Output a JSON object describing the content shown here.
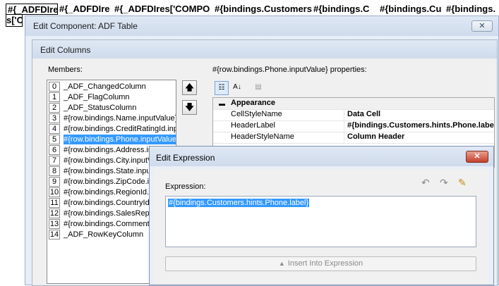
{
  "background": {
    "header_cells": [
      "#{_ADFDIre",
      "#{_ADFDIre",
      "#{_ADFDIres['COMPO",
      "#{bindings.Customers",
      "#{bindings.C",
      "#{bindings.Cu",
      "#{bindings."
    ],
    "row2_text": "s['C"
  },
  "edit_component": {
    "title": "Edit Component: ADF Table",
    "close_icon": "close-icon"
  },
  "edit_columns": {
    "title": "Edit Columns",
    "members_label": "Members:",
    "members": [
      {
        "index": "0",
        "label": "_ADF_ChangedColumn"
      },
      {
        "index": "1",
        "label": "_ADF_FlagColumn"
      },
      {
        "index": "2",
        "label": "_ADF_StatusColumn"
      },
      {
        "index": "3",
        "label": "#{row.bindings.Name.inputValue}"
      },
      {
        "index": "4",
        "label": "#{row.bindings.CreditRatingId.inputValue}"
      },
      {
        "index": "5",
        "label": "#{row.bindings.Phone.inputValue}"
      },
      {
        "index": "6",
        "label": "#{row.bindings.Address.inputValue}"
      },
      {
        "index": "7",
        "label": "#{row.bindings.City.inputValue}"
      },
      {
        "index": "8",
        "label": "#{row.bindings.State.inputValue}"
      },
      {
        "index": "9",
        "label": "#{row.bindings.ZipCode.inputValue}"
      },
      {
        "index": "10",
        "label": "#{row.bindings.RegionId.inputValue}"
      },
      {
        "index": "11",
        "label": "#{row.bindings.CountryId.inputValue}"
      },
      {
        "index": "12",
        "label": "#{row.bindings.SalesRepId.inputValue}"
      },
      {
        "index": "13",
        "label": "#{row.bindings.Comments.inputValue}"
      },
      {
        "index": "14",
        "label": "_ADF_RowKeyColumn"
      }
    ],
    "selected_member_index": 5,
    "move_up_icon": "arrow-up-icon",
    "move_down_icon": "arrow-down-icon",
    "properties_label": "#{row.bindings.Phone.inputValue} properties:",
    "toolbar": {
      "categorized_icon": "categorized-icon",
      "sort_icon": "sort-alpha-icon",
      "pages_icon": "property-pages-icon"
    },
    "property_category": "Appearance",
    "properties": [
      {
        "name": "CellStyleName",
        "value": "Data Cell"
      },
      {
        "name": "HeaderLabel",
        "value": "#{bindings.Customers.hints.Phone.label}"
      },
      {
        "name": "HeaderStyleName",
        "value": "Column Header"
      }
    ]
  },
  "edit_expression": {
    "title": "Edit Expression",
    "expression_label": "Expression:",
    "expression_value": "#{bindings.Customers.hints.Phone.label}",
    "insert_button": "Insert Into Expression",
    "tools": {
      "undo_icon": "undo-icon",
      "redo_icon": "redo-icon",
      "clear_icon": "eraser-icon"
    }
  }
}
